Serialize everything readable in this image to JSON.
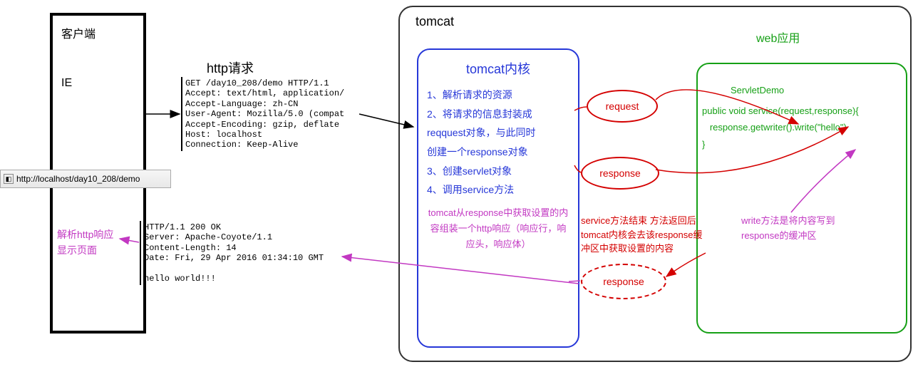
{
  "client": {
    "title": "客户端",
    "browser": "IE",
    "url": "http://localhost/day10_208/demo"
  },
  "http_request": {
    "title": "http请求",
    "raw": "GET /day10_208/demo HTTP/1.1\nAccept: text/html, application/\nAccept-Language: zh-CN\nUser-Agent: Mozilla/5.0 (compat\nAccept-Encoding: gzip, deflate\nHost: localhost\nConnection: Keep-Alive"
  },
  "http_response": {
    "raw": "HTTP/1.1 200 OK\nServer: Apache-Coyote/1.1\nContent-Length: 14\nDate: Fri, 29 Apr 2016 01:34:10 GMT\n\nhello world!!!"
  },
  "parse_note": {
    "line1": "解析http响应",
    "line2": "显示页面"
  },
  "tomcat": {
    "outer_title": "tomcat",
    "kernel_title": "tomcat内核",
    "step1": "1、解析请求的资源",
    "step2a": "2、将请求的信息封装成",
    "step2b": "reqquest对象，与此同时",
    "step2c": "创建一个response对象",
    "step3": "3、创建servlet对象",
    "step4": "4、调用service方法",
    "bottom": "tomcat从response中获取设置的内容组装一个http响应（响应行，响应头，响应体）"
  },
  "webapp": {
    "title": "web应用",
    "servlet": "ServletDemo",
    "code": "public void service(request,response){\n   response.getwriter().write(\"hello\")\n}"
  },
  "bubbles": {
    "request": "request",
    "response1": "response",
    "response2": "response"
  },
  "service_note": "service方法结束 方法返回后tomcat内核会去该response缓冲区中获取设置的内容",
  "write_note": "write方法是将内容写到response的缓冲区"
}
